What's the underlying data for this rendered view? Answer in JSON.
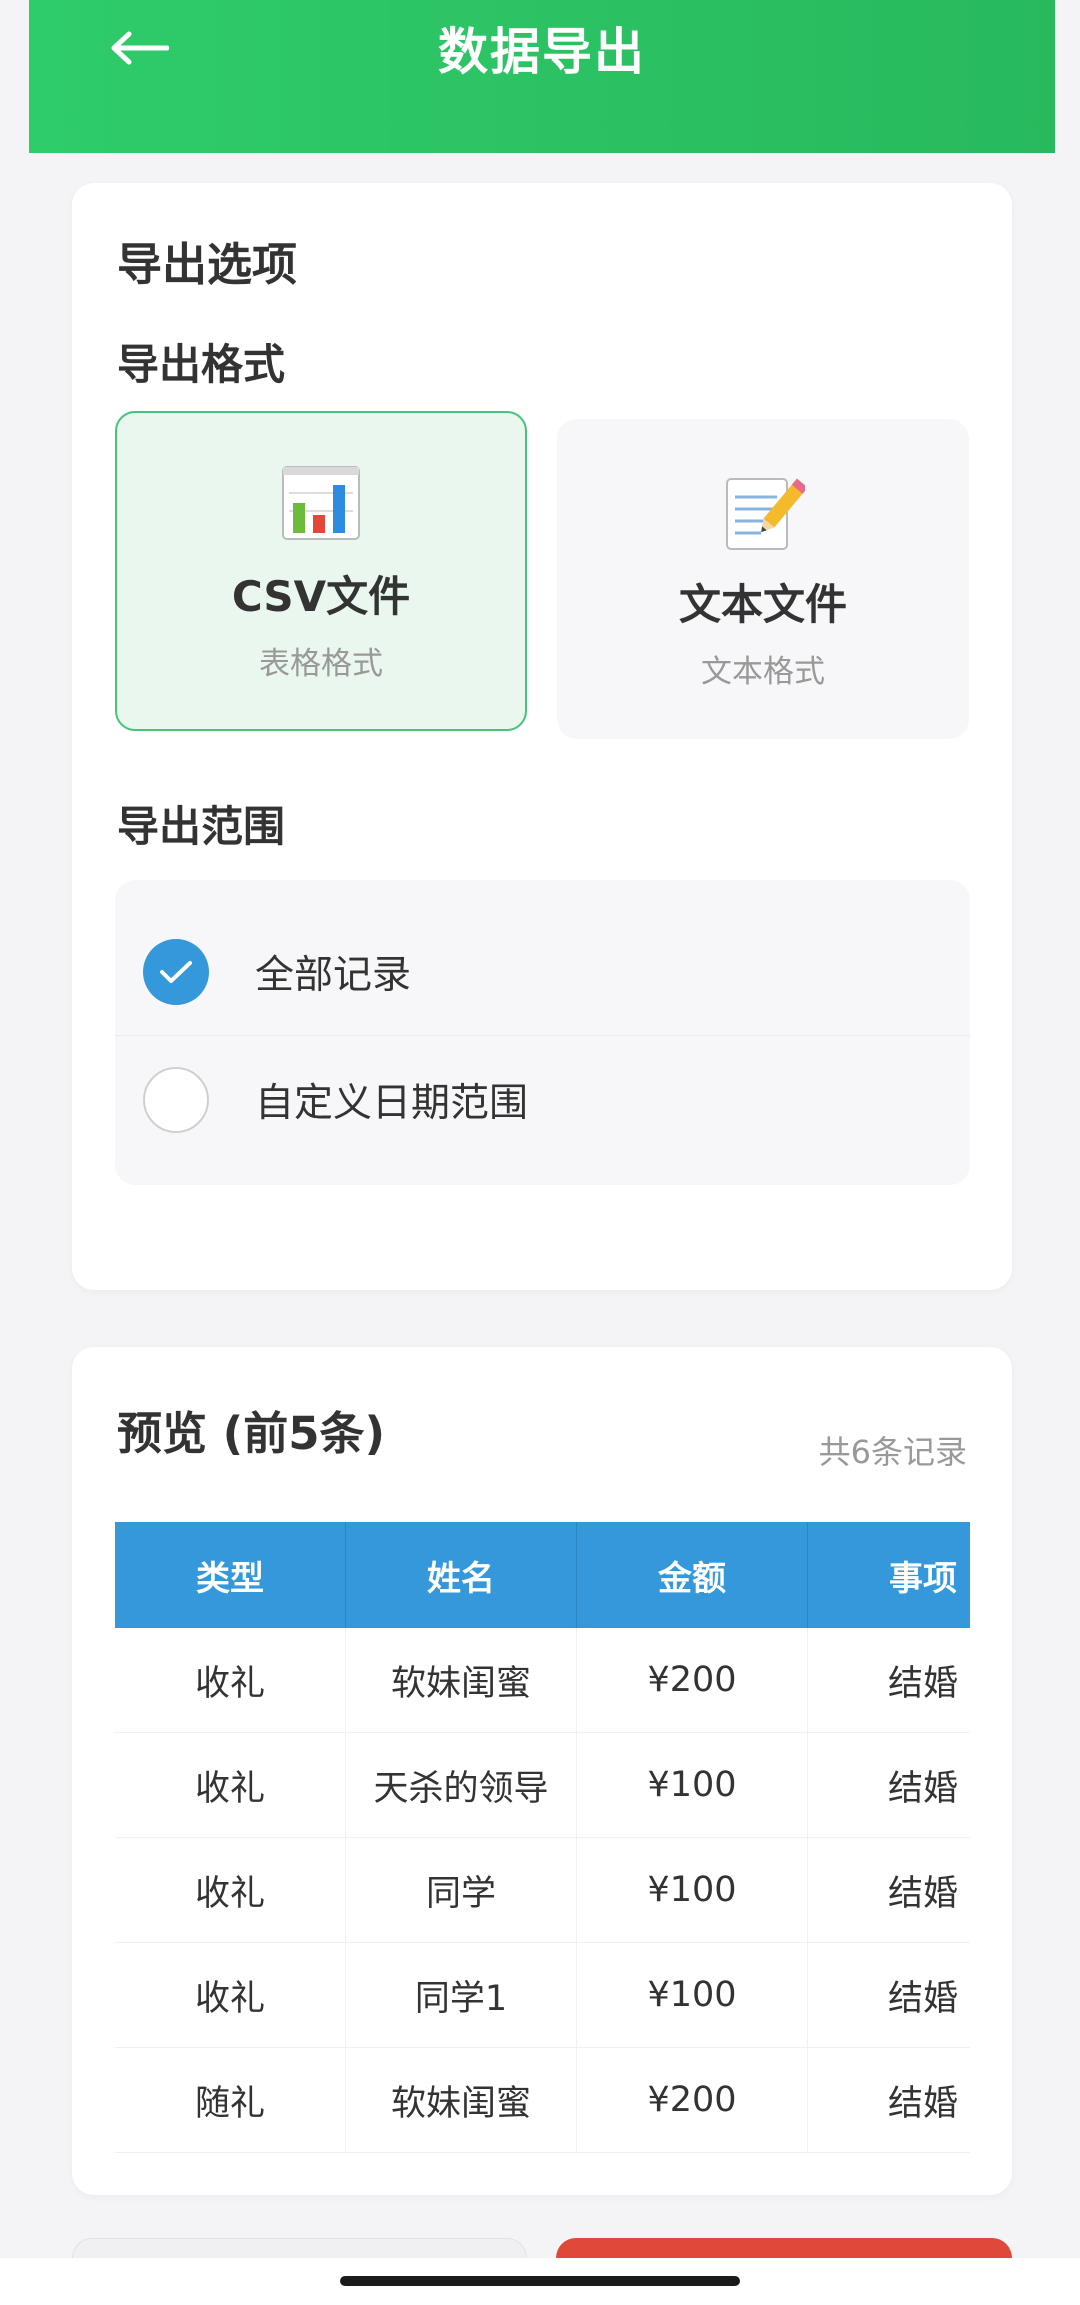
{
  "header": {
    "title": "数据导出"
  },
  "options": {
    "title": "导出选项",
    "format_label": "导出格式",
    "formats": [
      {
        "name": "CSV文件",
        "sub": "表格格式",
        "icon": "bar-chart-icon",
        "selected": true
      },
      {
        "name": "文本文件",
        "sub": "文本格式",
        "icon": "memo-pencil-icon",
        "selected": false
      }
    ],
    "range_label": "导出范围",
    "ranges": [
      {
        "label": "全部记录",
        "checked": true
      },
      {
        "label": "自定义日期范围",
        "checked": false
      }
    ]
  },
  "preview": {
    "title": "预览 (前5条)",
    "count": "共6条记录",
    "columns": [
      "类型",
      "姓名",
      "金额",
      "事项"
    ],
    "rows": [
      [
        "收礼",
        "软妹闺蜜",
        "¥200",
        "结婚"
      ],
      [
        "收礼",
        "天杀的领导",
        "¥100",
        "结婚"
      ],
      [
        "收礼",
        "同学",
        "¥100",
        "结婚"
      ],
      [
        "收礼",
        "同学1",
        "¥100",
        "结婚"
      ],
      [
        "随礼",
        "软妹闺蜜",
        "¥200",
        "结婚"
      ]
    ]
  },
  "colors": {
    "header_green": "#2fcc6a",
    "accent_blue": "#3498db",
    "selected_border": "#46c47c",
    "danger_red": "#e0483a"
  }
}
